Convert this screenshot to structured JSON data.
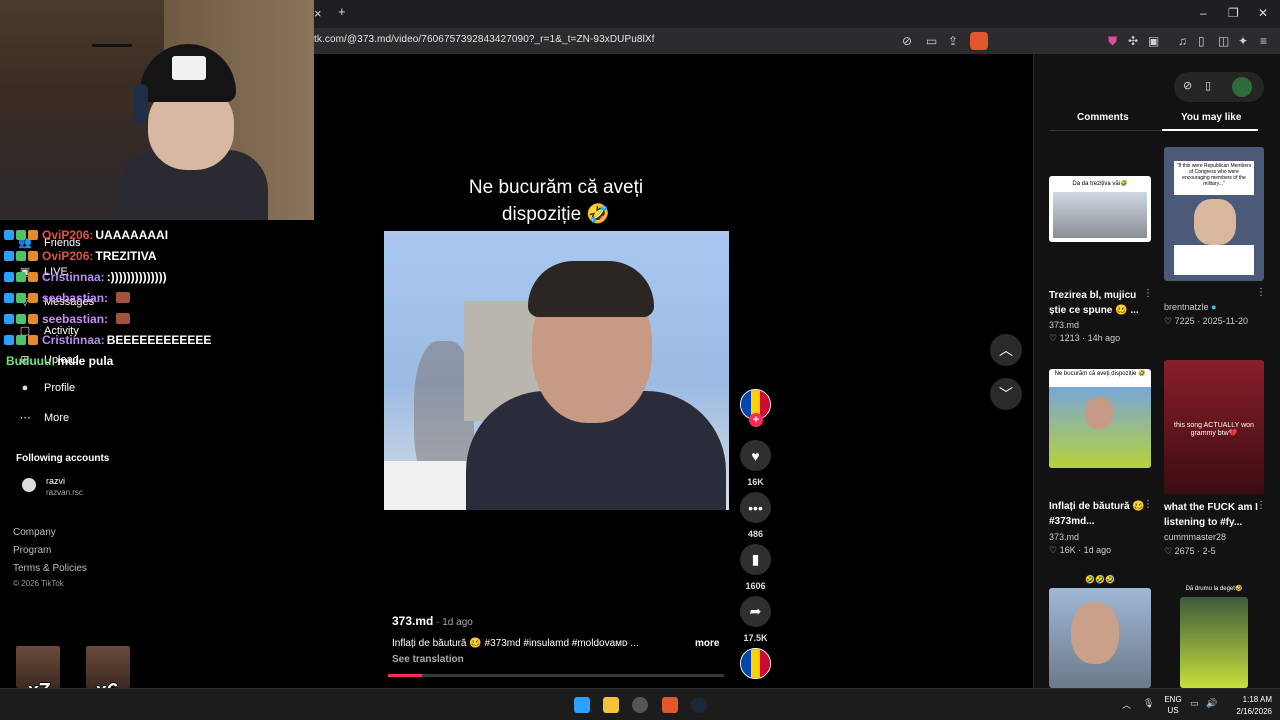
{
  "browser": {
    "url": "tk.com/@373.md/video/7606757392843427090?_r=1&_t=ZN-93xDUPu8lXf",
    "tab_close": "×",
    "new_tab": "+",
    "minimize": "–",
    "restore": "❐",
    "close": "✕"
  },
  "chat": [
    {
      "name": "OviP206:",
      "text": "UAAAAAAAI",
      "color": "#e0533c"
    },
    {
      "name": "OviP206:",
      "text": "TREZITIVA",
      "color": "#e0533c"
    },
    {
      "name": "Cristinnaa:",
      "text": ":))))))))))))))",
      "color": "#b58cf0"
    },
    {
      "name": "seebastian:",
      "text": "",
      "color": "#c78cf5"
    },
    {
      "name": "seebastian:",
      "text": "",
      "color": "#c78cf5"
    },
    {
      "name": "Cristinnaa:",
      "text": "BEEEEEEEEEEEE",
      "color": "#b58cf0"
    },
    {
      "name": "Buduuu:",
      "text": "muie pula",
      "color": "#6fe37a"
    }
  ],
  "sidebar": {
    "items": [
      {
        "label": "Friends",
        "icon": "friends-icon"
      },
      {
        "label": "LIVE",
        "icon": "live-icon"
      },
      {
        "label": "Messages",
        "icon": "messages-icon"
      },
      {
        "label": "Activity",
        "icon": "activity-icon"
      },
      {
        "label": "Upload",
        "icon": "upload-icon"
      },
      {
        "label": "Profile",
        "icon": "profile-icon"
      },
      {
        "label": "More",
        "icon": "more-icon"
      }
    ],
    "following_label": "Following accounts",
    "following": {
      "name": "razvi",
      "handle": "razvan.rsc"
    },
    "footer": [
      "Company",
      "Program",
      "Terms & Policies"
    ],
    "copyright": "© 2026 TikTok"
  },
  "emotes": [
    {
      "count": "x7"
    },
    {
      "count": "x6"
    }
  ],
  "video": {
    "caption_line1": "Ne bucurăm că aveți",
    "caption_line2": "dispoziție 🤣",
    "author": "373.md",
    "date": " · 1d ago",
    "description": "Inflați de băutură 🥴 #373md #insulamd #moldovaᴍᴅ ...",
    "more": "more",
    "see_translation": "See translation",
    "progress": 0.1
  },
  "actions": {
    "likes": "16K",
    "comments": "486",
    "saves": "1606",
    "shares": "17.5K"
  },
  "right_panel": {
    "tabs": {
      "comments": "Comments",
      "you_may_like": "You may like"
    },
    "cards": [
      {
        "title": "Trezirea bl, mujicu știe ce spune 🥴 ...",
        "author": "373.md",
        "likes": "1213",
        "date": "14h ago",
        "thumb_caption": "Da da trezițiva văi🤣"
      },
      {
        "title": "",
        "author": "brentnatzle",
        "likes": "7225",
        "date": "2025-11-20",
        "thumb_caption": "\"If this were Republican Members of Congress who were encouraging members of the military...\""
      },
      {
        "title": "Inflați de băutură 🥴 #373md...",
        "author": "373.md",
        "likes": "16K",
        "date": "1d ago",
        "thumb_caption": "Ne bucurăm că aveți dispoziție 🤣"
      },
      {
        "title": "what the FUCK am I listening to #fy...",
        "author": "cummmaster28",
        "likes": "2675",
        "date": "2-5",
        "thumb_caption": "this song ACTUALLY won grammy btw💔"
      },
      {
        "title": "",
        "author": "",
        "likes": "",
        "date": "",
        "thumb_caption": "🤣🤣🤣"
      },
      {
        "title": "",
        "author": "",
        "likes": "",
        "date": "",
        "thumb_caption": "Dă drumu la deget🤣"
      }
    ]
  },
  "taskbar": {
    "lang1": "ENG",
    "lang2": "US",
    "time": "1:18 AM",
    "date": "2/16/2026"
  }
}
